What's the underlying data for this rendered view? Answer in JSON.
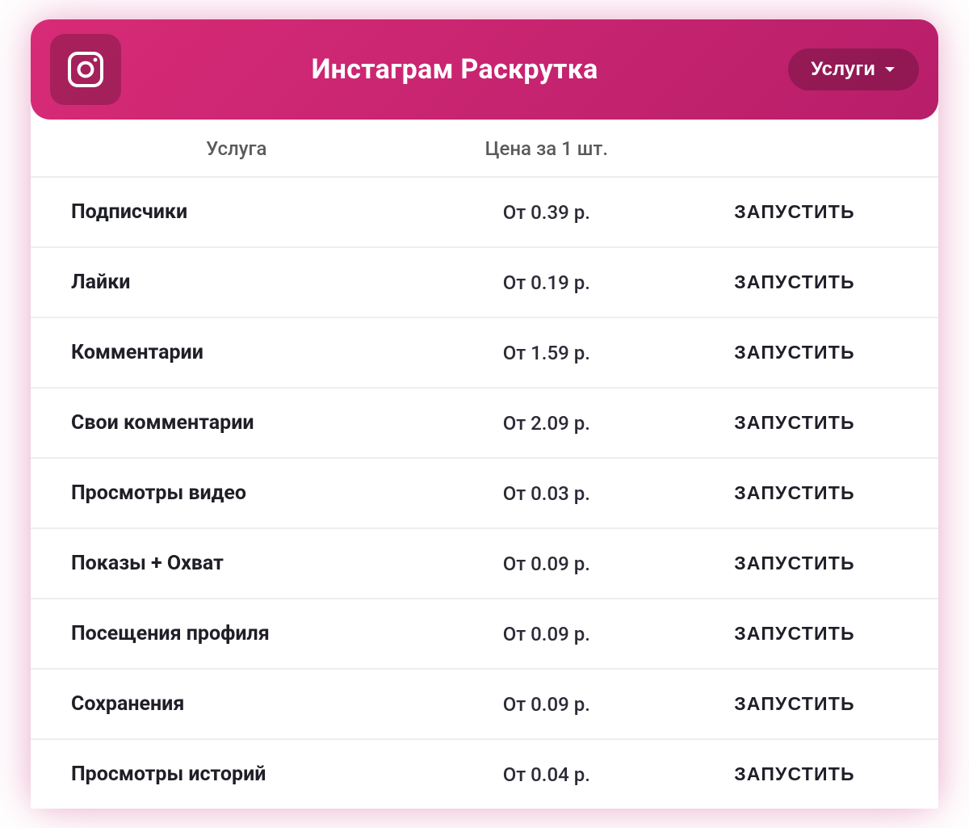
{
  "header": {
    "title": "Инстаграм Раскрутка",
    "dropdown_label": "Услуги",
    "icon": "instagram-icon"
  },
  "columns": {
    "service": "Услуга",
    "price": "Цена за 1 шт."
  },
  "action_label": "ЗАПУСТИТЬ",
  "rows": [
    {
      "service": "Подписчики",
      "price": "От 0.39 р."
    },
    {
      "service": "Лайки",
      "price": "От 0.19 р."
    },
    {
      "service": "Комментарии",
      "price": "От 1.59 р."
    },
    {
      "service": "Свои комментарии",
      "price": "От 2.09 р."
    },
    {
      "service": "Просмотры видео",
      "price": "От 0.03 р."
    },
    {
      "service": "Показы + Охват",
      "price": "От 0.09 р."
    },
    {
      "service": "Посещения профиля",
      "price": "От 0.09 р."
    },
    {
      "service": "Сохранения",
      "price": "От 0.09 р."
    },
    {
      "service": "Просмотры историй",
      "price": "От 0.04 р."
    }
  ]
}
